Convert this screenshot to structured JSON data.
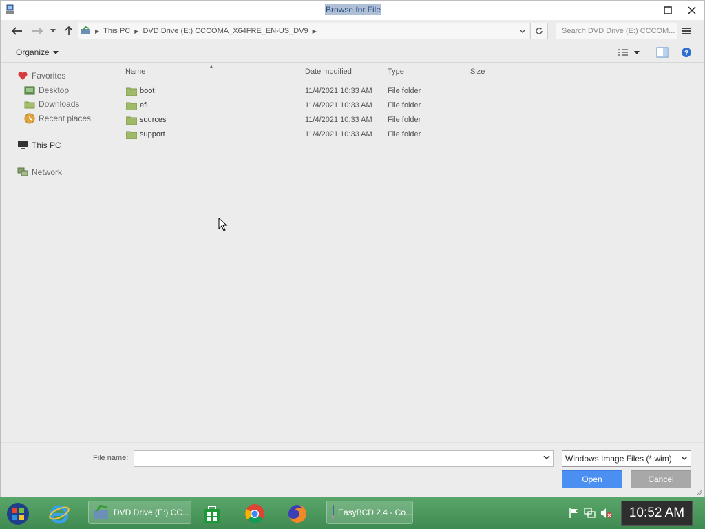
{
  "window": {
    "title": "Browse for File"
  },
  "address": {
    "crumbs": [
      "This PC",
      "DVD Drive (E:) CCCOMA_X64FRE_EN-US_DV9"
    ],
    "search_placeholder": "Search DVD Drive (E:) CCCOM..."
  },
  "toolbar": {
    "organize_label": "Organize"
  },
  "navpane": {
    "favorites": "Favorites",
    "desktop": "Desktop",
    "downloads": "Downloads",
    "recent": "Recent places",
    "this_pc": "This PC",
    "network": "Network"
  },
  "columns": {
    "name": "Name",
    "date": "Date modified",
    "type": "Type",
    "size": "Size"
  },
  "files": [
    {
      "name": "boot",
      "date": "11/4/2021 10:33 AM",
      "type": "File folder"
    },
    {
      "name": "efi",
      "date": "11/4/2021 10:33 AM",
      "type": "File folder"
    },
    {
      "name": "sources",
      "date": "11/4/2021 10:33 AM",
      "type": "File folder"
    },
    {
      "name": "support",
      "date": "11/4/2021 10:33 AM",
      "type": "File folder"
    }
  ],
  "bottom": {
    "filename_label": "File name:",
    "filename_value": "",
    "filter": "Windows Image Files (*.wim)",
    "open_label": "Open",
    "cancel_label": "Cancel"
  },
  "taskbar": {
    "tasks": [
      "DVD Drive (E:) CC...",
      "EasyBCD 2.4 - Co..."
    ],
    "clock": "10:52 AM"
  },
  "colors": {
    "accent": "#4b8ff2",
    "taskbar": "#4a9a5c",
    "title_highlight": "#aebfd6"
  }
}
